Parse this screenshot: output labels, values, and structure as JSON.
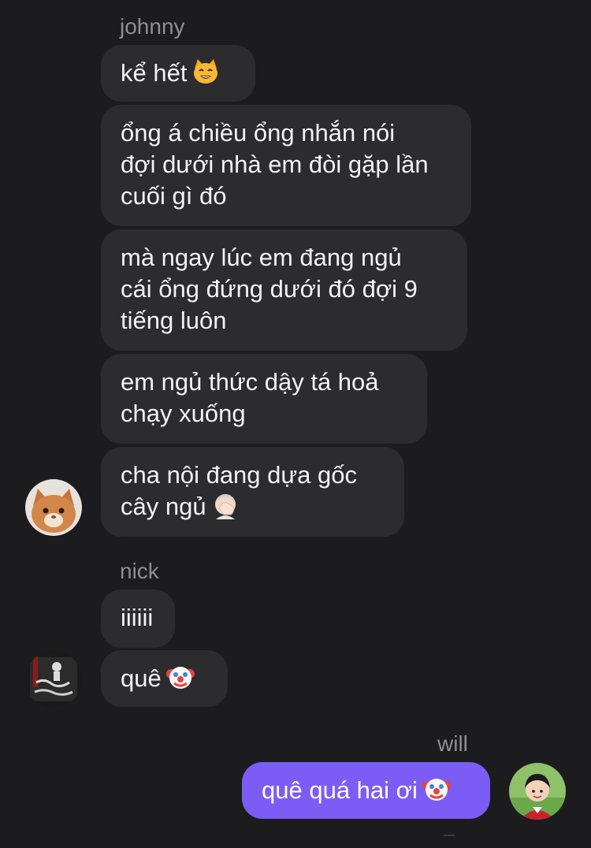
{
  "thread": {
    "groups": [
      {
        "sender": "johnny",
        "messages": [
          {
            "lines": [
              "kể hết"
            ],
            "emoji": "smiling-cat-face-emoji"
          },
          {
            "lines": [
              "ổng á chiều ổng nhắn nói",
              "đợi dưới nhà em đòi gặp lần",
              "cuối gì đó"
            ]
          },
          {
            "lines": [
              "mà ngay lúc em đang ngủ",
              "cái ổng đứng dưới đó đợi 9",
              "tiếng luôn"
            ]
          },
          {
            "lines": [
              "em ngủ thức dậy tá hoả",
              "chạy xuống"
            ]
          },
          {
            "lines": [
              "cha nội đang dựa gốc",
              "cây ngủ"
            ],
            "emoji": "face-palm-emoji"
          }
        ],
        "avatar": "cat-avatar"
      },
      {
        "sender": "nick",
        "messages": [
          {
            "lines": [
              "iiiiii"
            ]
          },
          {
            "lines": [
              "quê"
            ],
            "emoji": "clown-face-emoji"
          }
        ],
        "avatar": "graffiti-avatar"
      },
      {
        "sender": "will",
        "messages": [
          {
            "lines": [
              "quê quá hai ơi"
            ],
            "emoji": "clown-face-emoji"
          }
        ],
        "avatar": "child-photo-avatar"
      }
    ]
  },
  "colors": {
    "background": "#1c1c1e",
    "incoming_bubble": "#2c2c2e",
    "outgoing_bubble": "#7b5cf5",
    "sender_name": "#8e8e93"
  }
}
